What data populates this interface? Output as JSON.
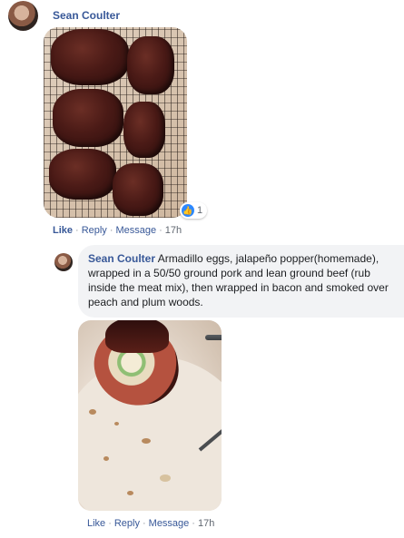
{
  "top_comment": {
    "author": "Sean Coulter",
    "reaction_count": "1",
    "actions": {
      "like": "Like",
      "reply": "Reply",
      "message": "Message",
      "time": "17h",
      "sep": "·"
    }
  },
  "reply": {
    "author": "Sean Coulter",
    "text": "Armadillo eggs, jalapeño popper(homemade), wrapped in a 50/50 ground pork and lean ground beef (rub inside the meat mix), then wrapped in bacon and smoked over peach and plum woods.",
    "actions": {
      "like": "Like",
      "reply": "Reply",
      "message": "Message",
      "time": "17h",
      "sep": "·"
    }
  },
  "icons": {
    "reaction": "like-thumb-icon"
  },
  "colors": {
    "link": "#385898",
    "meta": "#606770",
    "bubble": "#f2f3f5",
    "reaction_blue": "#2d88ff"
  }
}
